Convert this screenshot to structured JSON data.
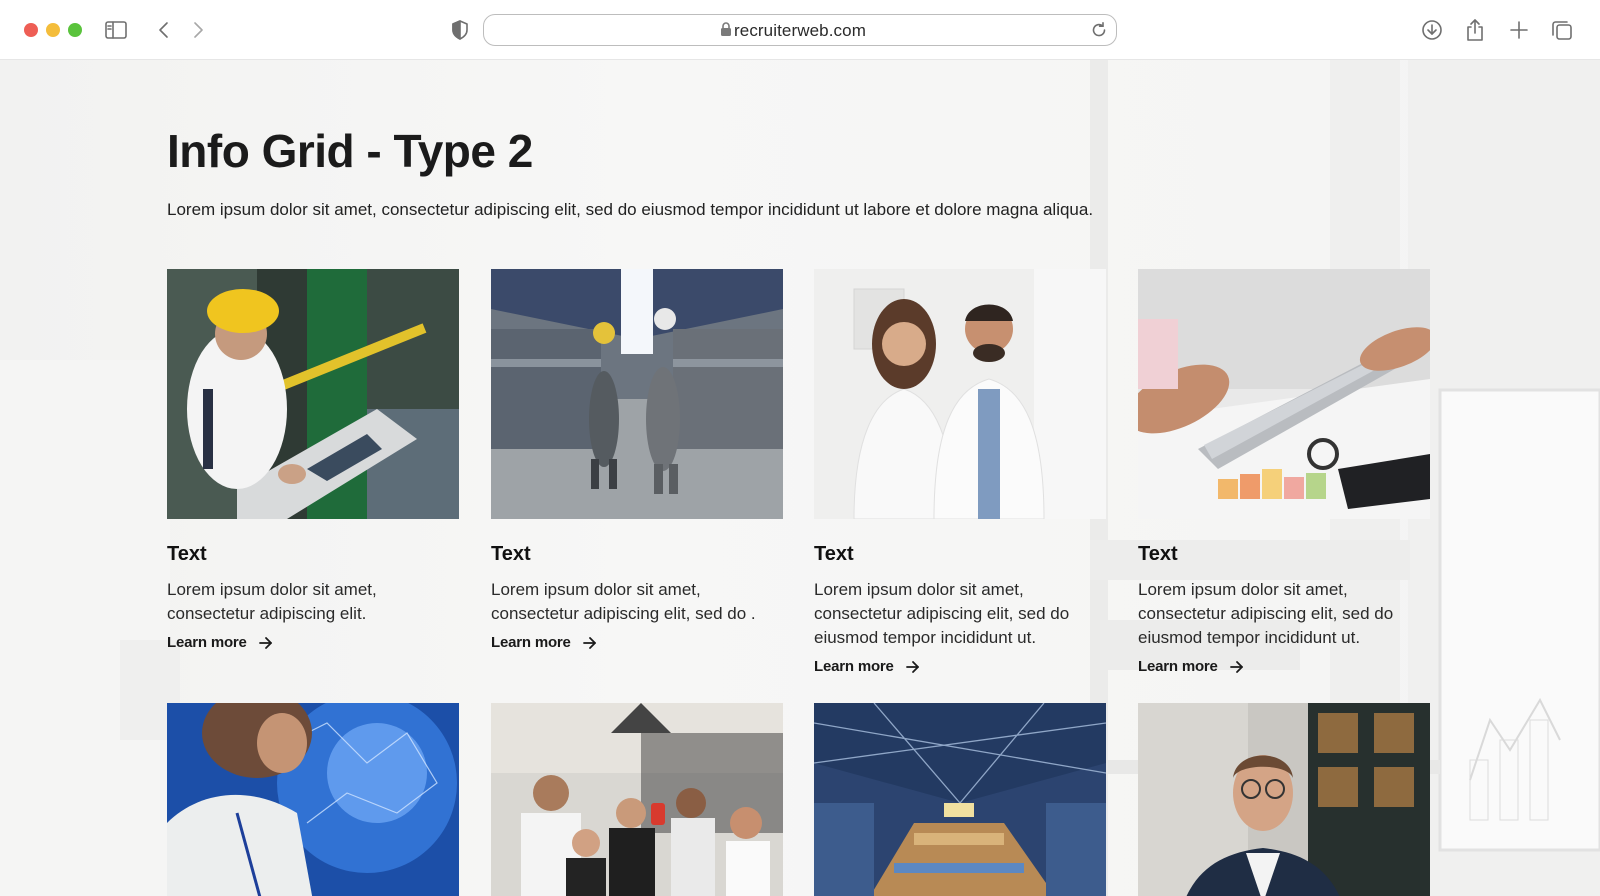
{
  "browser": {
    "url": "recruiterweb.com"
  },
  "page": {
    "title": "Info Grid - Type 2",
    "subtitle": "Lorem ipsum dolor sit amet, consectetur adipiscing elit, sed do eiusmod tempor incididunt ut labore et dolore magna aliqua."
  },
  "cards": [
    {
      "image": "worker-at-control-panel",
      "title": "Text",
      "body": "Lorem ipsum dolor sit amet, consectetur adipiscing elit.",
      "link": "Learn more"
    },
    {
      "image": "workers-walking-in-warehouse",
      "title": "Text",
      "body": "Lorem ipsum dolor sit amet, consectetur adipiscing elit, sed do .",
      "link": "Learn more"
    },
    {
      "image": "two-doctors-smiling",
      "title": "Text",
      "body": "Lorem ipsum dolor sit amet, consectetur adipiscing elit, sed do eiusmod tempor incididunt ut.",
      "link": "Learn more"
    },
    {
      "image": "hands-with-tablet-and-charts",
      "title": "Text",
      "body": "Lorem ipsum dolor sit amet, consectetur adipiscing elit, sed do eiusmod tempor incididunt ut.",
      "link": "Learn more"
    }
  ],
  "second_row_images": [
    "engineer-with-blue-network",
    "team-taking-selfie-in-office",
    "factory-interior-overhead",
    "man-with-glasses-portrait"
  ]
}
